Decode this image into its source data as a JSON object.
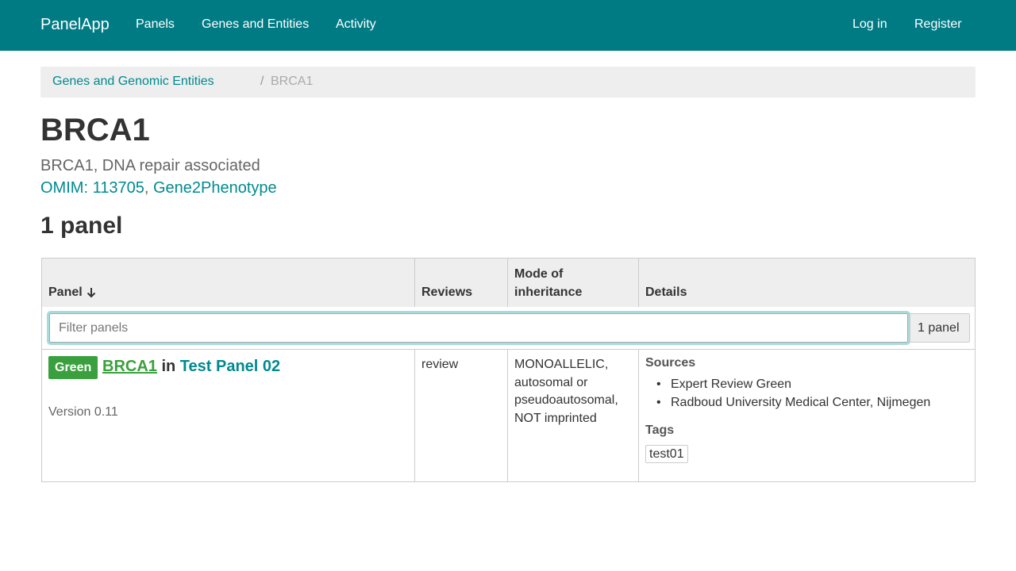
{
  "navbar": {
    "brand": "PanelApp",
    "links": [
      "Panels",
      "Genes and Entities",
      "Activity"
    ],
    "login": "Log in",
    "register": "Register"
  },
  "breadcrumb": {
    "parent": "Genes and Genomic Entities",
    "separator": "/",
    "current": "BRCA1"
  },
  "gene": {
    "symbol": "BRCA1",
    "name": "BRCA1, DNA repair associated",
    "omim_label": "OMIM",
    "omim_sep": ": ",
    "omim_id": "113705",
    "link_sep": ", ",
    "g2p_label": "Gene2Phenotype"
  },
  "panels_heading": "1 panel",
  "table": {
    "headers": {
      "panel": "Panel",
      "reviews": "Reviews",
      "moi_line1": "Mode of",
      "moi_line2": "inheritance",
      "details": "Details"
    },
    "sort_icon": "arrow-down",
    "filter": {
      "placeholder": "Filter panels",
      "count": "1 panel"
    },
    "row": {
      "rating": "Green",
      "gene": "BRCA1",
      "in_text": " in ",
      "panel": "Test Panel 02",
      "version": "Version 0.11",
      "review": "review",
      "moi_lines": [
        "MONOALLELIC,",
        "autosomal or",
        "pseudoautosomal,",
        "NOT imprinted"
      ],
      "sources_heading": "Sources",
      "sources": [
        "Expert Review Green",
        "Radboud University Medical Center, Nijmegen"
      ],
      "tags_heading": "Tags",
      "tag": "test01"
    }
  },
  "colors": {
    "navbar": "#007b84",
    "link": "#008a8f",
    "green": "#3aa03e",
    "breadcrumb_bg": "#eeeeee"
  }
}
